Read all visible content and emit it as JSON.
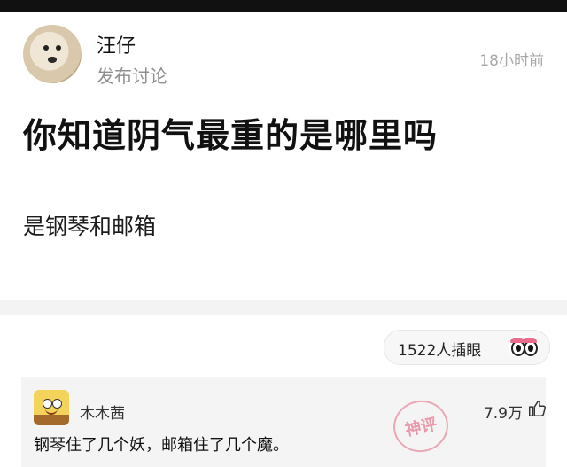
{
  "post": {
    "author": "汪仔",
    "meta": "发布讨论",
    "time": "18小时前",
    "title": "你知道阴气最重的是哪里吗",
    "answer": "是钢琴和邮箱"
  },
  "peek": {
    "label": "1522人插眼",
    "icon": "eyes-icon"
  },
  "comment": {
    "author": "木木茜",
    "likes": "7.9万",
    "text": "钢琴住了几个妖，邮箱住了几个魔。",
    "stamp_label": "神评",
    "stamp_color": "#e26882"
  }
}
